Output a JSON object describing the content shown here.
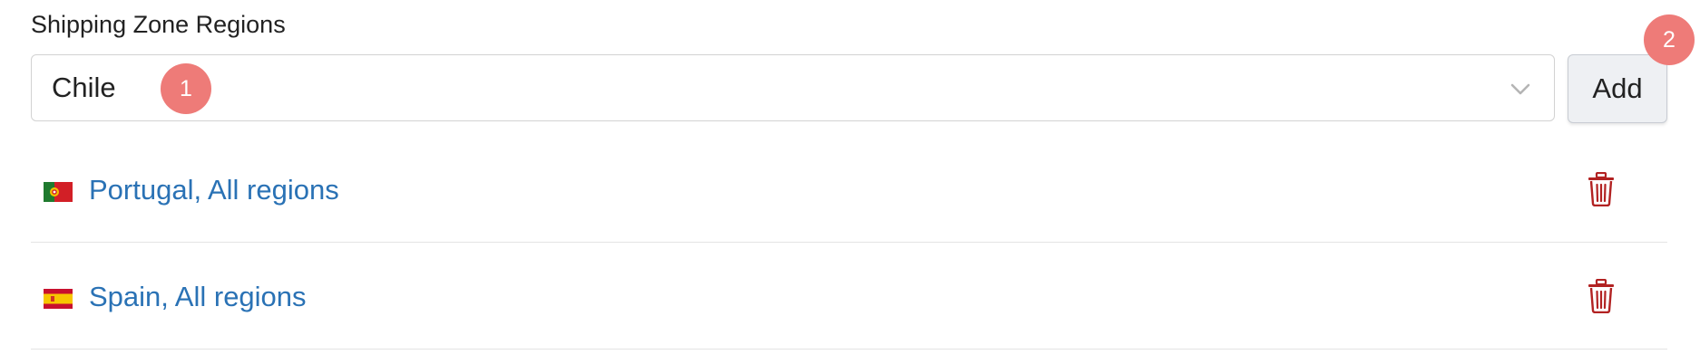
{
  "form": {
    "section_label": "Shipping Zone Regions",
    "region_select": {
      "selected_value": "Chile",
      "chevron_icon": "chevron-down-icon"
    },
    "add_button_label": "Add"
  },
  "markers": [
    {
      "label": "1"
    },
    {
      "label": "2"
    }
  ],
  "regions": [
    {
      "label": "Portugal, All regions",
      "flag": "portugal-flag-icon",
      "delete_icon": "trash-icon"
    },
    {
      "label": "Spain, All regions",
      "flag": "spain-flag-icon",
      "delete_icon": "trash-icon"
    }
  ],
  "colors": {
    "link": "#2a72b5",
    "delete": "#b22222",
    "marker": "#ee7b78",
    "button_bg": "#eef0f3",
    "border": "#d2d2d2"
  }
}
